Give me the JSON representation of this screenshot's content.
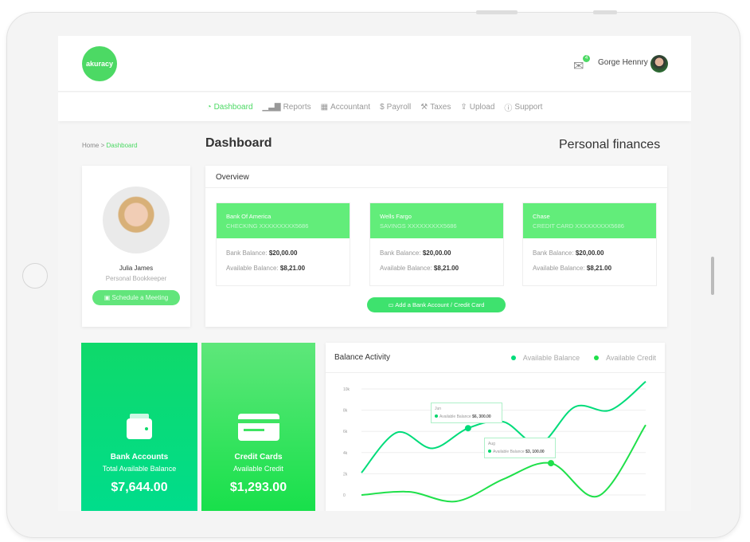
{
  "brand": {
    "logo_text": "akuracy",
    "accent": "#4cd964"
  },
  "header": {
    "user_name": "Gorge Hennry",
    "mail_badge": "4"
  },
  "nav": [
    {
      "label": "Dashboard",
      "icon": "gauge-icon",
      "active": true
    },
    {
      "label": "Reports",
      "icon": "bar-chart-icon"
    },
    {
      "label": "Accountant",
      "icon": "calculator-icon"
    },
    {
      "label": "Payroll",
      "icon": "dollar-icon"
    },
    {
      "label": "Taxes",
      "icon": "gavel-icon"
    },
    {
      "label": "Upload",
      "icon": "upload-icon"
    },
    {
      "label": "Support",
      "icon": "help-icon"
    }
  ],
  "breadcrumb": {
    "home": "Home",
    "sep": ">",
    "current": "Dashboard"
  },
  "page": {
    "title": "Dashboard",
    "subtitle": "Personal finances"
  },
  "profile": {
    "name": "Julia James",
    "role": "Personal Bookkeeper",
    "button": "Schedule a Meeting"
  },
  "overview": {
    "title": "Overview",
    "add_button": "Add a Bank Account / Credit Card",
    "accounts": [
      {
        "bank": "Bank Of America",
        "type": "CHECKING XXXXXXXXX5686",
        "bank_label": "Bank Balance:",
        "bank_balance": "$20,00.00",
        "avail_label": "Available Balance:",
        "avail_balance": "$8,21.00"
      },
      {
        "bank": "Wells Fargo",
        "type": "SAVINGS XXXXXXXXX5686",
        "bank_label": "Bank Balance:",
        "bank_balance": "$20,00.00",
        "avail_label": "Available Balance:",
        "avail_balance": "$8,21.00"
      },
      {
        "bank": "Chase",
        "type": "CREDIT CARD XXXXXXXXX5686",
        "bank_label": "Bank Balance:",
        "bank_balance": "$20,00.00",
        "avail_label": "Available Balance:",
        "avail_balance": "$8,21.00"
      }
    ]
  },
  "tiles": [
    {
      "title": "Bank Accounts",
      "subtitle": "Total Available Balance",
      "value": "$7,644.00",
      "icon": "wallet-icon"
    },
    {
      "title": "Credit Cards",
      "subtitle": "Available Credit",
      "value": "$1,293.00",
      "icon": "credit-card-icon"
    }
  ],
  "chart_data": {
    "type": "line",
    "title": "Balance Activity",
    "legend_position": "top-right",
    "grid": true,
    "ylim": [
      0,
      10000
    ],
    "yticks": [
      "0",
      "2k",
      "4k",
      "6k",
      "8k",
      "10k"
    ],
    "series": [
      {
        "name": "Available Balance",
        "color": "#00dc7a",
        "values": [
          2100,
          5900,
          4400,
          6300,
          6900,
          4800,
          8300,
          8000,
          10700
        ]
      },
      {
        "name": "Available Credit",
        "color": "#1fe04a",
        "values": [
          0,
          300,
          -600,
          1500,
          3000,
          -100,
          6600
        ]
      }
    ],
    "tooltips": [
      {
        "month": "Jun",
        "label": "Available Balance",
        "value": "$6, 300.00"
      },
      {
        "month": "Aug",
        "label": "Available Balance",
        "value": "$3, 100.00"
      }
    ]
  }
}
